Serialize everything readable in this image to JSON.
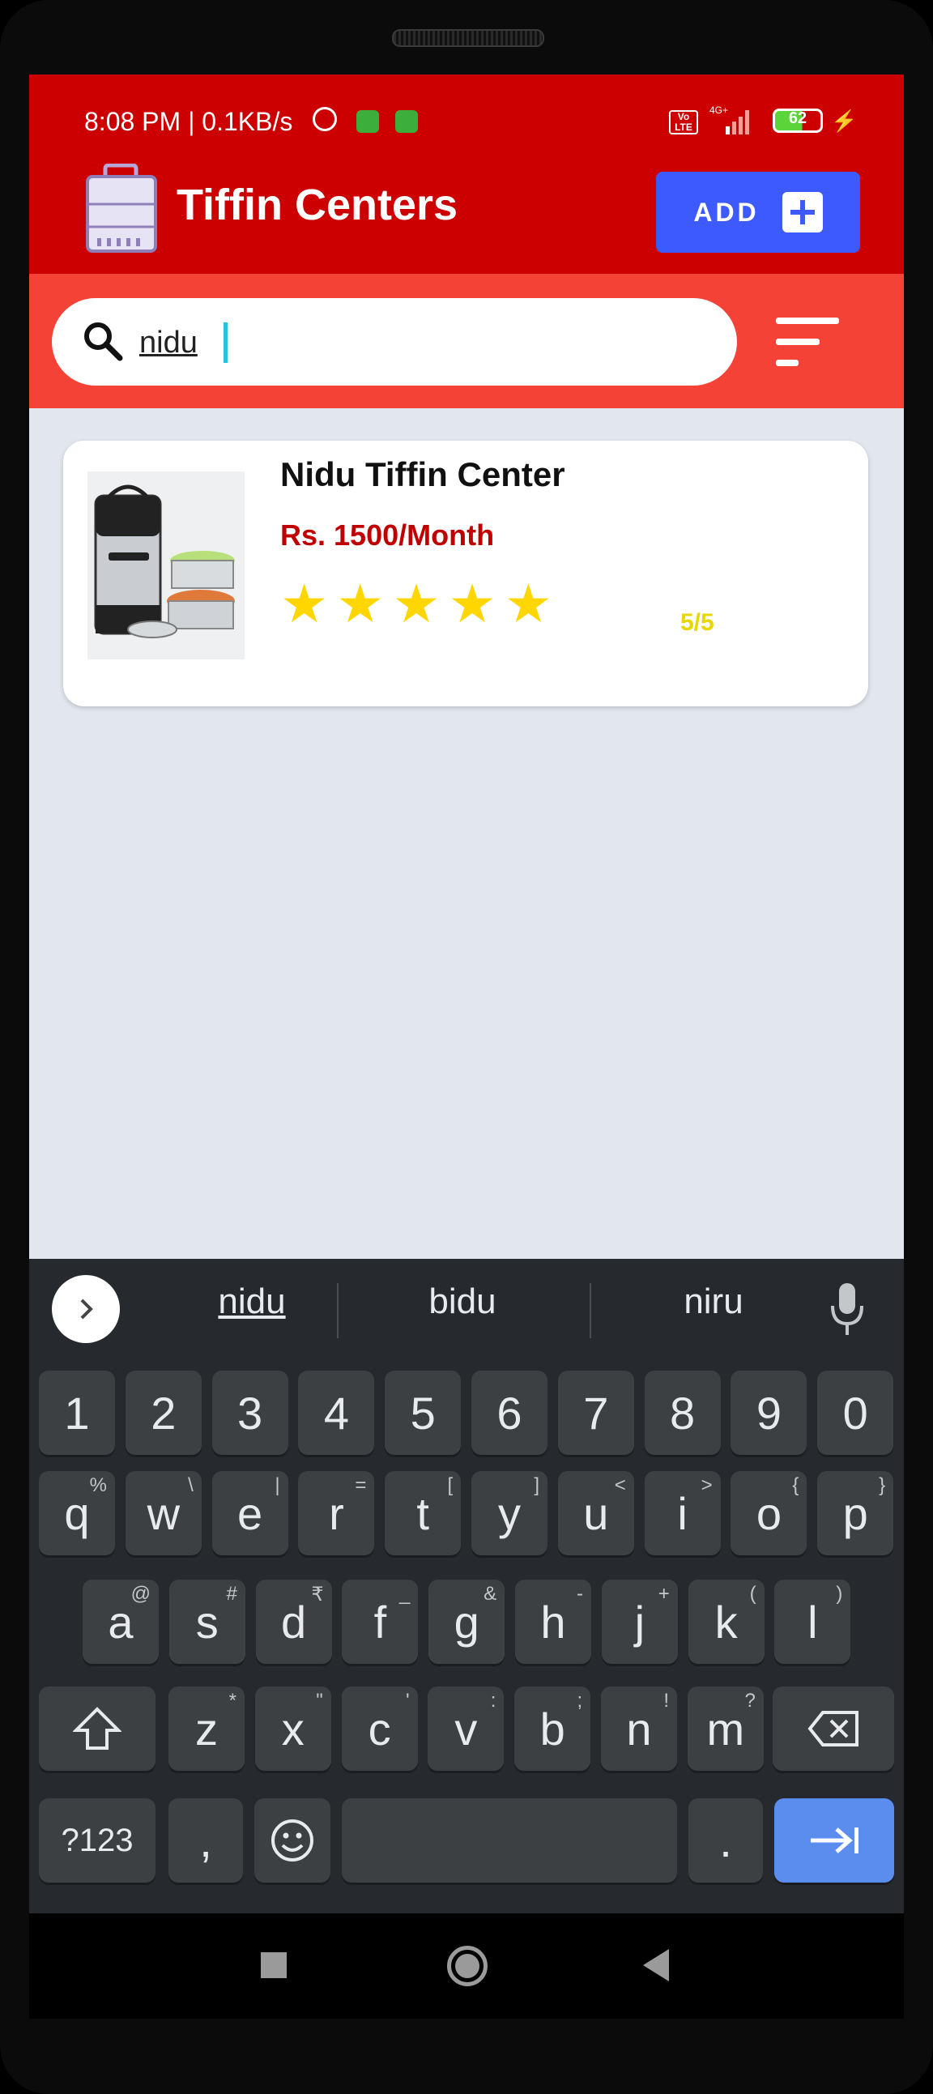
{
  "status_bar": {
    "time_network": "8:08 PM | 0.1KB/s",
    "volte": "Vo LTE",
    "network": "4G+",
    "battery": "62"
  },
  "app_bar": {
    "title": "Tiffin Centers",
    "add_label": "ADD",
    "icons": {
      "logo": "tiffin-box-icon",
      "add": "plus-icon"
    }
  },
  "search": {
    "value": "nidu",
    "icons": {
      "search": "search-icon",
      "sort": "sort-icon"
    }
  },
  "results": [
    {
      "name": "Nidu Tiffin Center",
      "price": "Rs. 1500/Month",
      "rating_stars": 5,
      "rating_text": "5/5",
      "image": "tiffin-box-product-image"
    }
  ],
  "keyboard": {
    "suggestions": [
      "nidu",
      "bidu",
      "niru"
    ],
    "number_row": [
      "1",
      "2",
      "3",
      "4",
      "5",
      "6",
      "7",
      "8",
      "9",
      "0"
    ],
    "row1": [
      {
        "key": "q",
        "hint": "%"
      },
      {
        "key": "w",
        "hint": "\\"
      },
      {
        "key": "e",
        "hint": "|"
      },
      {
        "key": "r",
        "hint": "="
      },
      {
        "key": "t",
        "hint": "["
      },
      {
        "key": "y",
        "hint": "]"
      },
      {
        "key": "u",
        "hint": "<"
      },
      {
        "key": "i",
        "hint": ">"
      },
      {
        "key": "o",
        "hint": "{"
      },
      {
        "key": "p",
        "hint": "}"
      }
    ],
    "row2": [
      {
        "key": "a",
        "hint": "@"
      },
      {
        "key": "s",
        "hint": "#"
      },
      {
        "key": "d",
        "hint": "₹"
      },
      {
        "key": "f",
        "hint": "_"
      },
      {
        "key": "g",
        "hint": "&"
      },
      {
        "key": "h",
        "hint": "-"
      },
      {
        "key": "j",
        "hint": "+"
      },
      {
        "key": "k",
        "hint": "("
      },
      {
        "key": "l",
        "hint": ")"
      }
    ],
    "row3": [
      {
        "key": "z",
        "hint": "*"
      },
      {
        "key": "x",
        "hint": "\""
      },
      {
        "key": "c",
        "hint": "'"
      },
      {
        "key": "v",
        "hint": ":"
      },
      {
        "key": "b",
        "hint": ";"
      },
      {
        "key": "n",
        "hint": "!"
      },
      {
        "key": "m",
        "hint": "?"
      }
    ],
    "symbols_label": "?123",
    "comma": ",",
    "period": ".",
    "icons": {
      "shift": "shift-icon",
      "backspace": "backspace-icon",
      "emoji": "emoji-icon",
      "enter": "tab-arrow-icon",
      "mic": "mic-icon",
      "expand": "chevron-right-icon"
    }
  },
  "colors": {
    "app_bar": "#cc0000",
    "search_bar": "#f44336",
    "add_button": "#3d5afe",
    "price": "#c00000",
    "star": "#ffd600",
    "keyboard_bg": "#262a2f",
    "key_bg": "#3c4043",
    "enter_key": "#5b8def"
  }
}
